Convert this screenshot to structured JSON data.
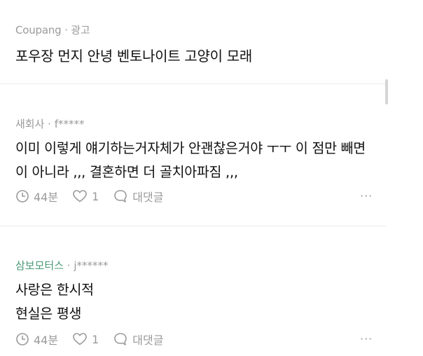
{
  "ad": {
    "advertiser": "Coupang",
    "separator": " · ",
    "ad_label": "광고",
    "title": "포우장 먼지 안녕 벤토나이트 고양이 모래"
  },
  "comments": [
    {
      "author": "새회사",
      "dot": " · ",
      "user": "f*****",
      "lines": [
        "이미 이렇게 얘기하는거자체가 안괜찮은거야 ㅜㅜ 이 점만 빼면",
        "이 아니라 ,,, 결혼하면 더 골치아파짐 ,,,"
      ],
      "time": "44분",
      "likes": "1",
      "reply_label": "대댓글",
      "more": "···"
    },
    {
      "author": "삼보모터스",
      "dot": " · ",
      "user": "j******",
      "lines": [
        "사랑은 한시적",
        "현실은 평생"
      ],
      "time": "44분",
      "likes": "1",
      "reply_label": "대댓글",
      "more": "···"
    }
  ],
  "colors": {
    "meta_gray": "#9a9a9a",
    "company_green": "#4a9a78",
    "separator": "#ececec"
  },
  "icons": [
    "clock-icon",
    "heart-icon",
    "comment-bubble-icon",
    "more-dots-icon"
  ]
}
